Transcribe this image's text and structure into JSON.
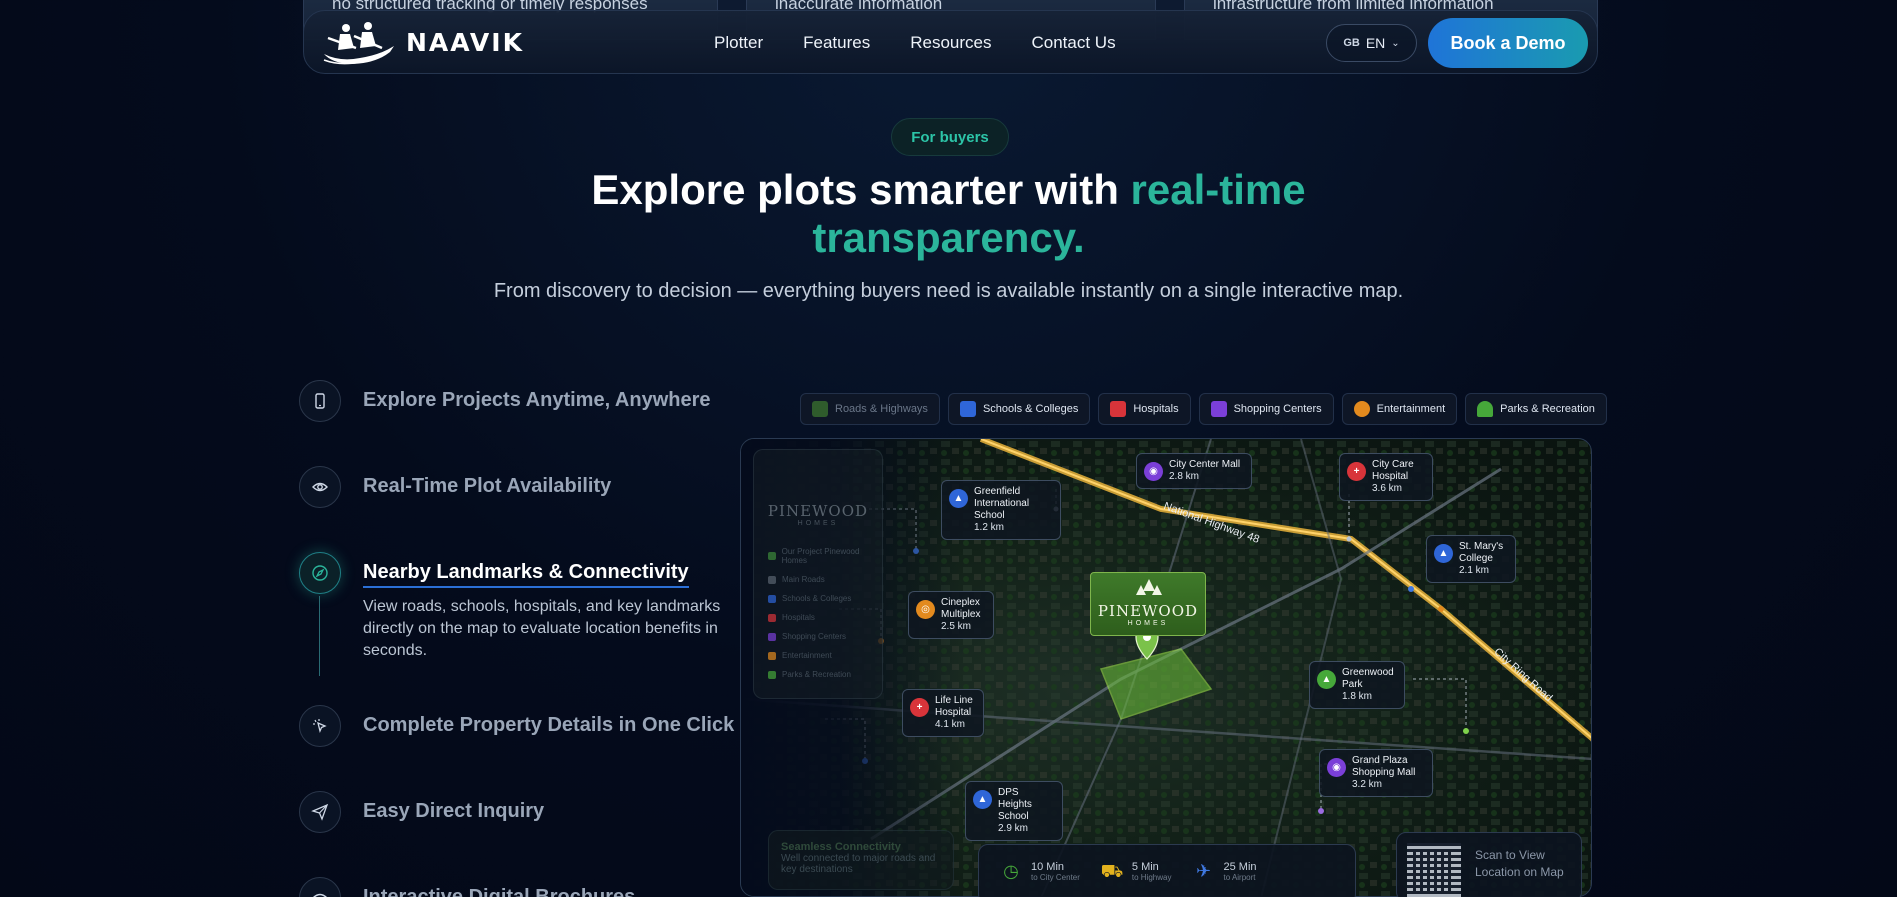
{
  "peek_cards": [
    "no structured tracking or timely responses",
    "inaccurate information",
    "infrastructure from limited information"
  ],
  "nav": {
    "brand": "NAAVIK",
    "links": [
      "Plotter",
      "Features",
      "Resources",
      "Contact Us"
    ],
    "lang_flag": "GB",
    "lang_code": "EN",
    "cta": "Book a Demo"
  },
  "hero": {
    "badge": "For buyers",
    "title_plain": "Explore plots smarter with ",
    "title_accent_1": "real-time",
    "title_accent_2": "transparency.",
    "subtitle": "From discovery to decision — everything buyers need is available instantly on a single interactive map."
  },
  "features": [
    {
      "title": "Explore Projects Anytime, Anywhere",
      "icon": "phone-icon"
    },
    {
      "title": "Real-Time Plot Availability",
      "icon": "eye-icon"
    },
    {
      "title": "Nearby Landmarks & Connectivity",
      "icon": "compass-icon",
      "desc": "View roads, schools, hospitals, and key landmarks directly on the map to evaluate location benefits in seconds."
    },
    {
      "title": "Complete Property Details in One Click",
      "icon": "cursor-click-icon"
    },
    {
      "title": "Easy Direct Inquiry",
      "icon": "send-icon"
    },
    {
      "title": "Interactive Digital Brochures",
      "icon": "brochure-icon"
    }
  ],
  "map": {
    "chips": [
      {
        "label": "Roads & Highways",
        "color": "#3d8a3a"
      },
      {
        "label": "Schools & Colleges",
        "color": "#2f66d8"
      },
      {
        "label": "Hospitals",
        "color": "#d8343a"
      },
      {
        "label": "Shopping Centers",
        "color": "#7b3fd8"
      },
      {
        "label": "Entertainment",
        "color": "#e38a1e"
      },
      {
        "label": "Parks & Recreation",
        "color": "#46a83a"
      }
    ],
    "side_panel": {
      "brand": "PINEWOOD",
      "sub": "HOMES",
      "items": [
        "Our Project Pinewood Homes",
        "Main Roads",
        "Schools & Colleges",
        "Hospitals",
        "Shopping Centers",
        "Entertainment",
        "Parks & Recreation"
      ]
    },
    "pins": [
      {
        "name": "Greenfield International School",
        "dist": "1.2 km",
        "color": "#2f66d8"
      },
      {
        "name": "City Center Mall",
        "dist": "2.8 km",
        "color": "#7b3fd8"
      },
      {
        "name": "City Care Hospital",
        "dist": "3.6 km",
        "color": "#d8343a"
      },
      {
        "name": "St. Mary's College",
        "dist": "2.1 km",
        "color": "#2f66d8"
      },
      {
        "name": "Cineplex Multiplex",
        "dist": "2.5 km",
        "color": "#e38a1e"
      },
      {
        "name": "Greenwood Park",
        "dist": "1.8 km",
        "color": "#46a83a"
      },
      {
        "name": "Life Line Hospital",
        "dist": "4.1 km",
        "color": "#d8343a"
      },
      {
        "name": "Grand Plaza Shopping Mall",
        "dist": "3.2 km",
        "color": "#7b3fd8"
      },
      {
        "name": "DPS Heights School",
        "dist": "2.9 km",
        "color": "#2f66d8"
      }
    ],
    "project": {
      "name": "PINEWOOD",
      "sub": "HOMES"
    },
    "roads": [
      "National Highway 48",
      "City Ring Road"
    ],
    "connectivity_card": {
      "title": "Seamless Connectivity",
      "text": "Well connected to major roads and key destinations"
    },
    "travel": [
      {
        "time": "10 Min",
        "to": "to City Center"
      },
      {
        "time": "5 Min",
        "to": "to Highway"
      },
      {
        "time": "25 Min",
        "to": "to Airport"
      }
    ],
    "qr": {
      "line1": "Scan to View",
      "line2": "Location on Map"
    }
  }
}
